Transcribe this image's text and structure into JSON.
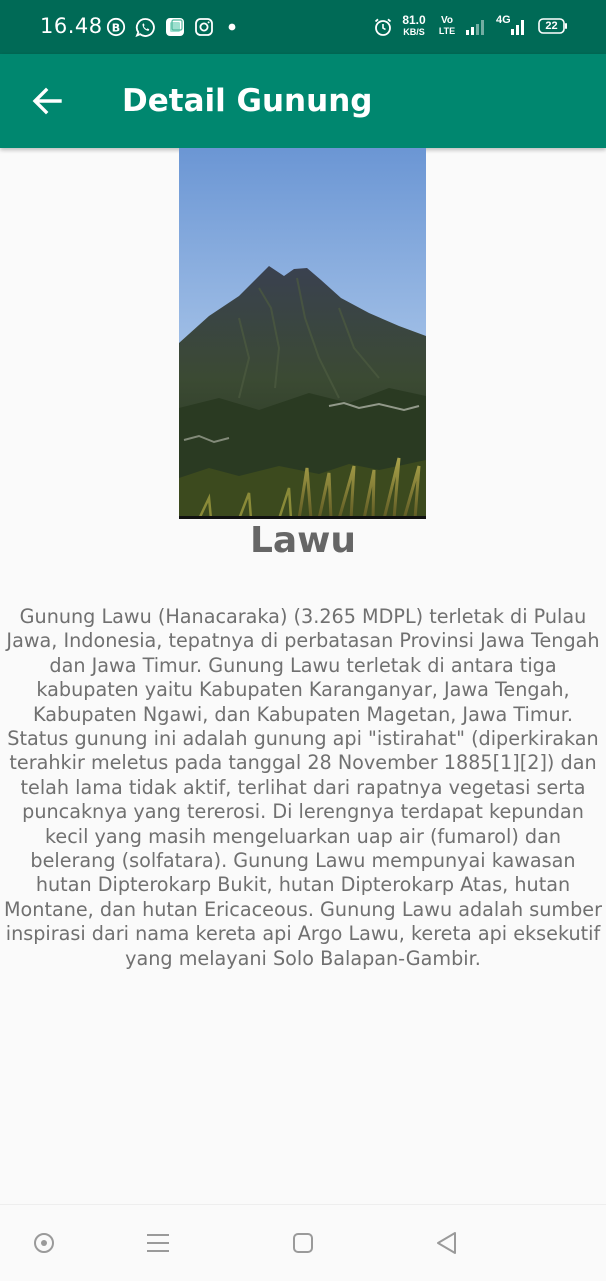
{
  "status_bar": {
    "time": "16.48",
    "network_speed_value": "81.0",
    "network_speed_unit": "KB/S",
    "volte_top": "Vo",
    "volte_bottom": "LTE",
    "network_type": "4G",
    "battery": "22",
    "icons": [
      "b-icon",
      "whatsapp-icon",
      "app-icon",
      "instagram-icon",
      "dot-icon",
      "alarm-icon",
      "signal-icon",
      "signal-4g-icon",
      "battery-icon"
    ]
  },
  "app_bar": {
    "title": "Detail Gunung",
    "back_icon": "arrow-back-icon"
  },
  "mountain": {
    "name": "Lawu",
    "description": "Gunung Lawu (Hanacaraka) (3.265 MDPL) terletak di Pulau Jawa, Indonesia, tepatnya di perbatasan Provinsi Jawa Tengah dan Jawa Timur. Gunung Lawu terletak di antara tiga kabupaten yaitu Kabupaten Karanganyar, Jawa Tengah, Kabupaten Ngawi, dan Kabupaten Magetan, Jawa Timur. Status gunung ini adalah gunung api \"istirahat\" (diperkirakan terahkir meletus pada tanggal 28 November 1885[1][2]) dan telah lama tidak aktif, terlihat dari rapatnya vegetasi serta puncaknya yang tererosi. Di lerengnya terdapat kepundan kecil yang masih mengeluarkan uap air (fumarol) dan belerang (solfatara). Gunung Lawu mempunyai kawasan hutan Dipterokarp Bukit, hutan Dipterokarp Atas, hutan Montane, dan hutan Ericaceous. Gunung Lawu adalah sumber inspirasi dari nama kereta api Argo Lawu, kereta api eksekutif yang melayani Solo Balapan-Gambir."
  },
  "nav_bar": {
    "buttons": [
      "assistant-icon",
      "recents-menu-icon",
      "home-square-icon",
      "back-triangle-icon"
    ]
  },
  "colors": {
    "status_bar": "#006a56",
    "app_bar": "#00876f",
    "text": "#707070",
    "title_text": "#666666"
  }
}
